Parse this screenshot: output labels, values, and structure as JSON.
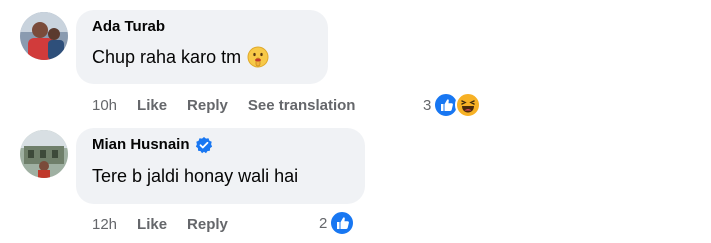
{
  "comments": [
    {
      "author": "Ada Turab",
      "text": "Chup raha karo tm",
      "emoji_icon": "shushing-face-icon",
      "verified": false,
      "time": "10h",
      "like_label": "Like",
      "reply_label": "Reply",
      "translate_label": "See translation",
      "reaction_count": "3",
      "reactions": [
        "like-reaction-icon",
        "haha-reaction-icon"
      ]
    },
    {
      "author": "Mian Husnain",
      "text": "Tere b jaldi honay wali hai",
      "verified": true,
      "time": "12h",
      "like_label": "Like",
      "reply_label": "Reply",
      "reaction_count": "2",
      "reactions": [
        "like-reaction-icon"
      ]
    }
  ],
  "colors": {
    "bubble": "#f0f2f5",
    "meta_text": "#65676b",
    "like_blue": "#1877f2",
    "haha_yellow": "#f7b125"
  }
}
